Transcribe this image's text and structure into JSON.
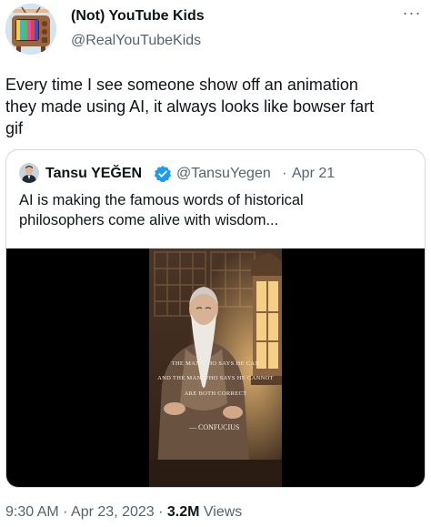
{
  "tweet": {
    "author_name": "(Not) YouTube Kids",
    "author_handle": "@RealYouTubeKids",
    "more_label": "···",
    "text": "Every time I see someone show off an animation\nthey made using AI, it always looks like bowser fart\ngif"
  },
  "quote": {
    "author_name": "Tansu YEĞEN",
    "author_handle": "@TansuYegen",
    "separator": "·",
    "date": "Apr 21",
    "text": "AI is making the famous words of historical\nphilosophers come alive with wisdom...",
    "media": {
      "caption_lines": [
        "THE MAN WHO SAYS HE CAN",
        "AND THE MAN WHO SAYS HE CANNOT",
        "ARE BOTH CORRECT"
      ],
      "attribution": "— CONFUCIUS"
    }
  },
  "footer": {
    "time": "9:30 AM",
    "sep1": " · ",
    "date": "Apr 23, 2023",
    "sep2": " · ",
    "views_count": "3.2M",
    "views_label": " Views"
  },
  "colors": {
    "text": "#0f1419",
    "secondary": "#536471",
    "border": "#cfd9de",
    "verified": "#1d9bf0",
    "media_bg": "#000000"
  },
  "icons": {
    "author_avatar": "retro-tv-avatar",
    "quote_avatar": "person-avatar",
    "verified": "verified-badge-icon",
    "more": "more-horizontal-icon"
  }
}
